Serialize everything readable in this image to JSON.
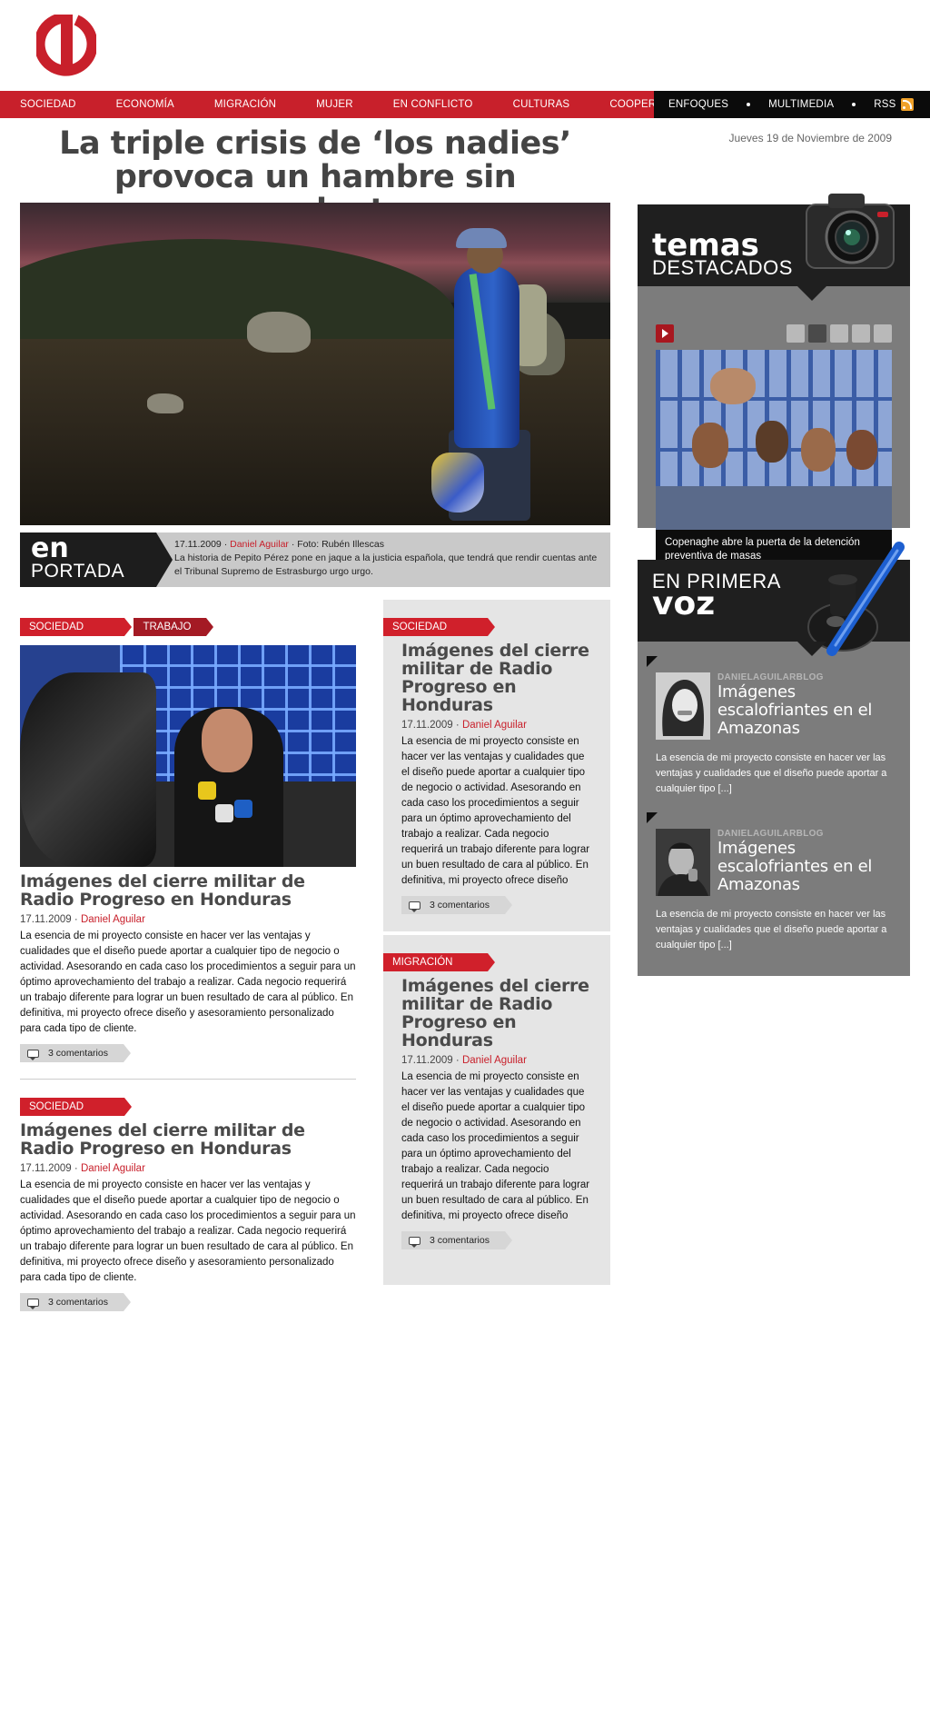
{
  "nav": {
    "red_items": [
      "SOCIEDAD",
      "ECONOMÍA",
      "MIGRACIÓN",
      "MUJER",
      "EN CONFLICTO",
      "CULTURAS",
      "COOPERACIÓN"
    ],
    "black_items": [
      "ENFOQUES",
      "MULTIMEDIA",
      "RSS"
    ]
  },
  "headline": "La triple crisis de ‘los nadies’ provoca un hambre sin precedentes",
  "date": "Jueves 19 de Noviembre de 2009",
  "portada": {
    "tag_big": "en",
    "tag_small": "PORTADA",
    "date": "17.11.2009 ·",
    "author": "Daniel Aguilar",
    "photo": "· Foto: Rubén Illescas",
    "text": "La historia de Pepito Pérez pone en jaque a la justicia española, que tendrá que rendir cuentas ante el Tribunal Supremo de Estrasburgo urgo urgo."
  },
  "left_articles": [
    {
      "tags": [
        "SOCIEDAD",
        "TRABAJO"
      ],
      "title": "Imágenes del cierre militar de Radio Progreso en Honduras",
      "date": "17.11.2009 ·",
      "author": "Daniel Aguilar",
      "excerpt": "La esencia de mi proyecto consiste en hacer ver las ventajas y cualidades que el diseño puede aportar a cualquier tipo de negocio o  actividad. Asesorando en cada caso los procedimientos a seguir para un óptimo aprovechamiento del trabajo a realizar. Cada negocio requerirá un trabajo diferente para lograr un buen resultado de cara al público. En definitiva, mi proyecto ofrece diseño y asesoramiento personalizado para cada tipo de cliente.",
      "comments": "3 comentarios"
    },
    {
      "tags": [
        "SOCIEDAD"
      ],
      "title": "Imágenes del cierre militar de Radio Progreso en Honduras",
      "date": "17.11.2009 ·",
      "author": "Daniel Aguilar",
      "excerpt": "La esencia de mi proyecto consiste en hacer ver las ventajas y cualidades que el diseño puede aportar a cualquier tipo de negocio o  actividad. Asesorando en cada caso los procedimientos a seguir para un óptimo aprovechamiento del trabajo a realizar. Cada negocio requerirá un trabajo diferente para lograr un buen resultado de cara al público. En definitiva, mi proyecto ofrece diseño y asesoramiento personalizado para cada tipo de cliente.",
      "comments": "3 comentarios"
    }
  ],
  "mid_articles": [
    {
      "tag": "SOCIEDAD",
      "title": "Imágenes del cierre militar de Radio Progreso en Honduras",
      "date": "17.11.2009 ·",
      "author": "Daniel Aguilar",
      "excerpt": "La esencia de mi proyecto consiste en hacer ver las ventajas y cualidades que el diseño puede aportar a cualquier tipo de negocio o  actividad. Asesorando en cada caso los procedimientos a seguir para un óptimo aprovechamiento del trabajo a realizar. Cada negocio requerirá un trabajo diferente para lograr un buen resultado de cara al público. En definitiva, mi proyecto ofrece diseño",
      "comments": "3 comentarios"
    },
    {
      "tag": "MIGRACIÓN",
      "title": "Imágenes del cierre militar de Radio Progreso en Honduras",
      "date": "17.11.2009 ·",
      "author": "Daniel Aguilar",
      "excerpt": "La esencia de mi proyecto consiste en hacer ver las ventajas y cualidades que el diseño puede aportar a cualquier tipo de negocio o  actividad. Asesorando en cada caso los procedimientos a seguir para un óptimo aprovechamiento del trabajo a realizar. Cada negocio requerirá un trabajo diferente para lograr un buen resultado de cara al público. En definitiva, mi proyecto ofrece diseño",
      "comments": "3 comentarios"
    }
  ],
  "temas": {
    "title_big": "temas",
    "title_small": "DESTACADOS",
    "caption": "Copenaghe abre la puerta de la detención preventiva de masas",
    "active_dot": 2,
    "dot_count": 5
  },
  "voz": {
    "title_small": "EN PRIMERA",
    "title_big": "voz",
    "items": [
      {
        "blog": "DANIELAGUILARBLOG",
        "title": "Imágenes escalofriantes en el Amazonas",
        "text": "La esencia de mi proyecto consiste en hacer ver las ventajas y cualidades que el diseño puede aportar a cualquier tipo [...]"
      },
      {
        "blog": "DANIELAGUILARBLOG",
        "title": "Imágenes escalofriantes en el Amazonas",
        "text": "La esencia de mi proyecto consiste en hacer ver las ventajas y cualidades que el diseño puede aportar a cualquier tipo [...]"
      }
    ]
  },
  "colors": {
    "brand_red": "#c8202b",
    "nav_black": "#0b0b0b",
    "sidebar_gray": "#7c7c7c",
    "mid_box_gray": "#e5e5e5"
  }
}
